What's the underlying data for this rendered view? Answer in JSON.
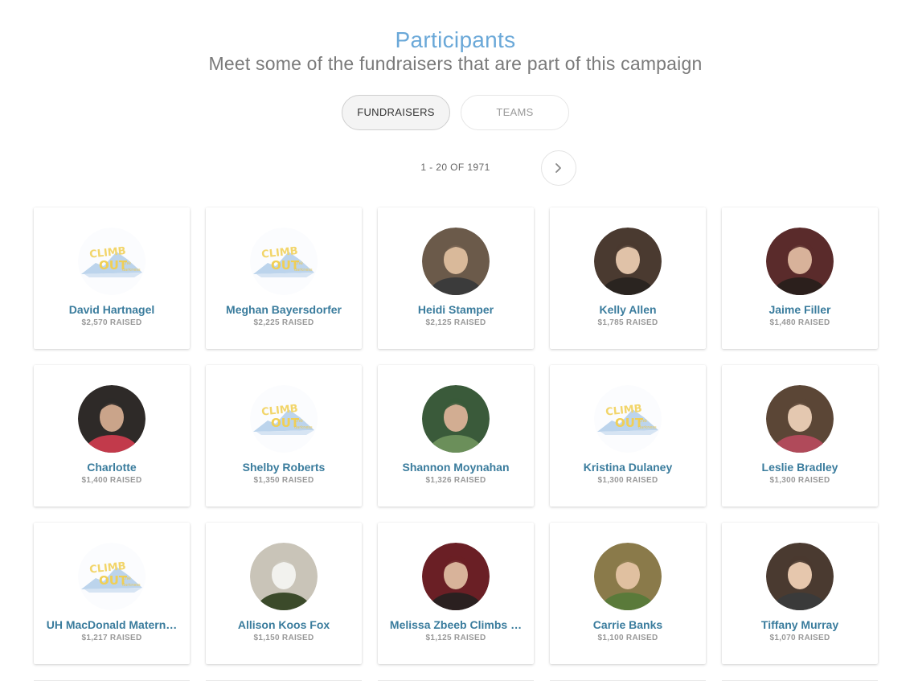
{
  "header": {
    "title": "Participants",
    "subtitle": "Meet some of the fundraisers that are part of this campaign"
  },
  "tabs": [
    {
      "label": "FUNDRAISERS",
      "active": true
    },
    {
      "label": "TEAMS",
      "active": false
    }
  ],
  "pagination": {
    "text": "1 - 20 OF 1971"
  },
  "participants": [
    {
      "name": "David Hartnagel",
      "raised": "$2,570 RAISED",
      "avatar": "climb-out-logo"
    },
    {
      "name": "Meghan Bayersdorfer",
      "raised": "$2,225 RAISED",
      "avatar": "climb-out-logo"
    },
    {
      "name": "Heidi Stamper",
      "raised": "$2,125 RAISED",
      "avatar": "photo"
    },
    {
      "name": "Kelly Allen",
      "raised": "$1,785 RAISED",
      "avatar": "photo"
    },
    {
      "name": "Jaime Filler",
      "raised": "$1,480 RAISED",
      "avatar": "photo"
    },
    {
      "name": "Charlotte",
      "raised": "$1,400 RAISED",
      "avatar": "photo"
    },
    {
      "name": "Shelby Roberts",
      "raised": "$1,350 RAISED",
      "avatar": "climb-out-logo"
    },
    {
      "name": "Shannon Moynahan",
      "raised": "$1,326 RAISED",
      "avatar": "photo"
    },
    {
      "name": "Kristina Dulaney",
      "raised": "$1,300 RAISED",
      "avatar": "climb-out-logo"
    },
    {
      "name": "Leslie Bradley",
      "raised": "$1,300 RAISED",
      "avatar": "photo"
    },
    {
      "name": "UH MacDonald Matern…",
      "raised": "$1,217 RAISED",
      "avatar": "climb-out-logo"
    },
    {
      "name": "Allison Koos Fox",
      "raised": "$1,150 RAISED",
      "avatar": "photo"
    },
    {
      "name": "Melissa Zbeeb Climbs …",
      "raised": "$1,125 RAISED",
      "avatar": "photo"
    },
    {
      "name": "Carrie Banks",
      "raised": "$1,100 RAISED",
      "avatar": "photo"
    },
    {
      "name": "Tiffany Murray",
      "raised": "$1,070 RAISED",
      "avatar": "photo"
    }
  ],
  "colors": {
    "title": "#6aa8d8",
    "name": "#3a7c9d",
    "raised": "#999999"
  }
}
